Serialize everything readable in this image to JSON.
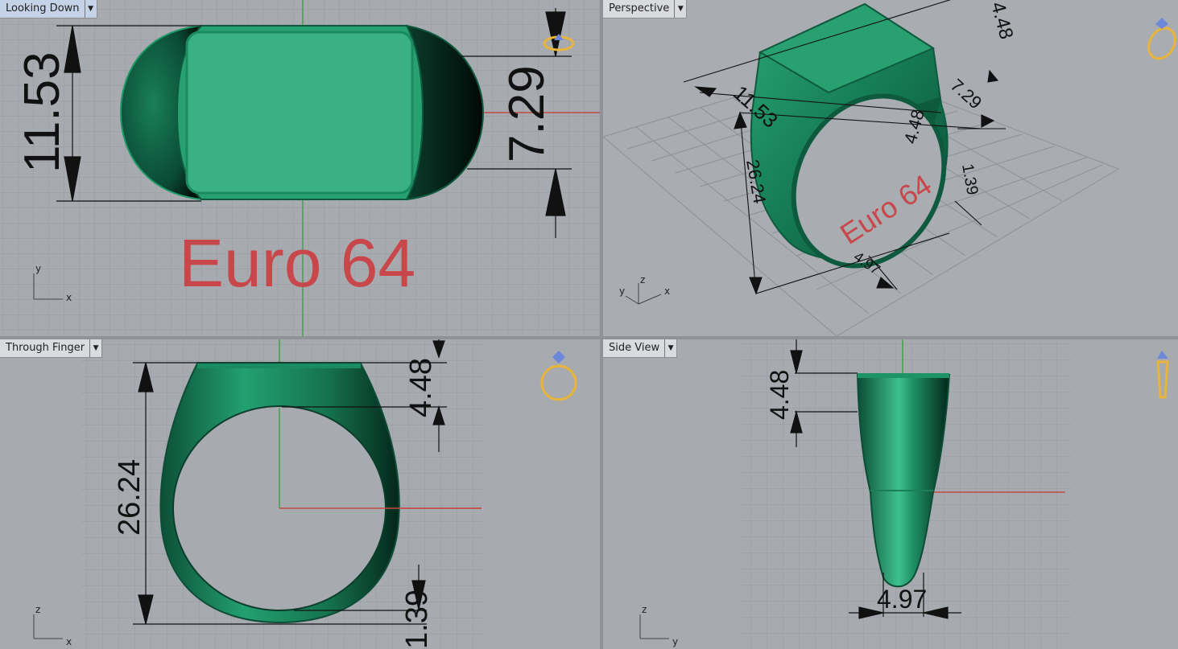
{
  "colors": {
    "ring": "#1f9a68",
    "ring_dark": "#07392a",
    "ring_face": "#35b087",
    "grid": "#969aa0",
    "grid_major": "#7d8187",
    "axis_x": "#c24a45",
    "axis_y": "#3fa34a",
    "text_red": "#c8474a",
    "gumball": "#e8b43a"
  },
  "viewports": {
    "top": {
      "title": "Looking Down",
      "dimensions": [
        "11.53",
        "7.29"
      ],
      "engraving": "Euro 64",
      "axes": {
        "v": "y",
        "h": "x"
      }
    },
    "perspective": {
      "title": "Perspective",
      "dimensions": [
        "4.48",
        "11.53",
        "7.29",
        "4.48",
        "26.24",
        "1.39",
        "4.97"
      ],
      "engraving": "Euro 64",
      "axes": {
        "a": "y",
        "b": "z",
        "c": "x"
      }
    },
    "front": {
      "title": "Through Finger",
      "dimensions": [
        "4.48",
        "26.24",
        "1.39"
      ],
      "axes": {
        "v": "z",
        "h": "x"
      }
    },
    "side": {
      "title": "Side View",
      "dimensions": [
        "4.48",
        "4.97"
      ],
      "axes": {
        "v": "z",
        "h": "y"
      }
    }
  },
  "icons": {
    "viewport_menu": "chevron-down-icon",
    "ring_orientation": "ring-gumball-icon"
  }
}
